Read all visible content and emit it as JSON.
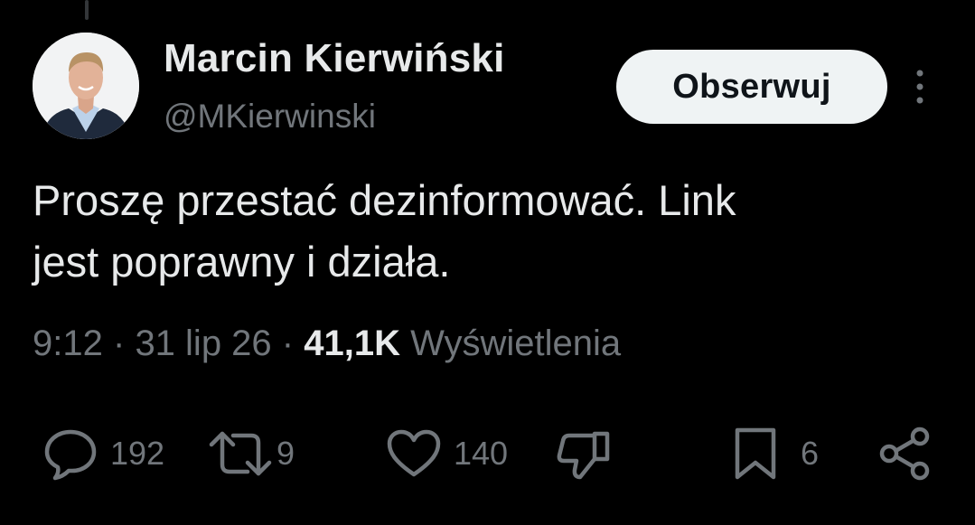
{
  "author": {
    "display_name": "Marcin Kierwiński",
    "handle": "@MKierwinski"
  },
  "follow_label": "Obserwuj",
  "tweet": {
    "line1": "Proszę przestać dezinformować. Link",
    "line2": "jest poprawny i działa."
  },
  "meta": {
    "time": "9:12",
    "separator": "·",
    "date": "31 lip 26",
    "views_count": "41,1K",
    "views_label": "Wyświetlenia"
  },
  "actions": {
    "replies": "192",
    "reposts": "9",
    "likes": "140",
    "bookmarks": "6"
  },
  "icons": {
    "reply": "reply-icon",
    "repost": "repost-icon",
    "like": "heart-icon",
    "dislike": "thumbs-down-icon",
    "bookmark": "bookmark-icon",
    "share": "share-icon",
    "more": "more-vertical-icon"
  },
  "colors": {
    "background": "#000000",
    "primary_text": "#e7e9ea",
    "secondary_text": "#71767b",
    "follow_button_bg": "#eff3f4"
  }
}
